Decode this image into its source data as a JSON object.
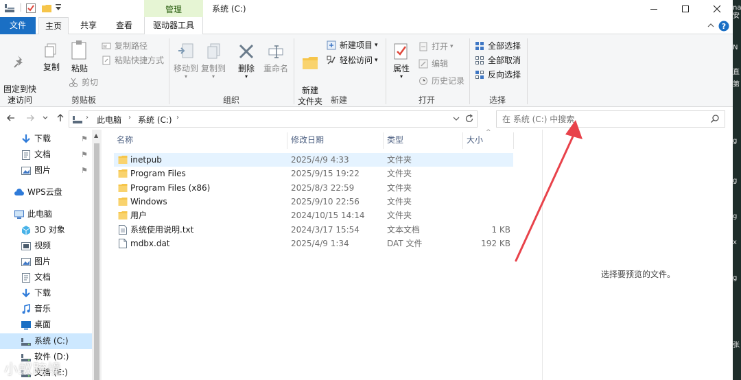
{
  "window": {
    "title": "系统 (C:)",
    "context_tab_group": "管理",
    "controls": {
      "minimize": "minimize",
      "maximize": "maximize",
      "close": "close"
    }
  },
  "ribbon": {
    "tabs": [
      {
        "label": "文件"
      },
      {
        "label": "主页"
      },
      {
        "label": "共享"
      },
      {
        "label": "查看"
      },
      {
        "label": "驱动器工具"
      }
    ],
    "groups": {
      "clipboard": {
        "label": "剪贴板",
        "pin_quick_access": "固定到快\n速访问",
        "copy": "复制",
        "paste": "粘贴",
        "copy_path": "复制路径",
        "paste_shortcut": "粘贴快捷方式",
        "cut": "剪切"
      },
      "organize": {
        "label": "组织",
        "move_to": "移动到",
        "copy_to": "复制到",
        "delete": "删除",
        "rename": "重命名"
      },
      "new": {
        "label": "新建",
        "new_folder": "新建\n文件夹",
        "new_item": "新建项目",
        "easy_access": "轻松访问"
      },
      "open": {
        "label": "打开",
        "properties": "属性",
        "open": "打开",
        "edit": "编辑",
        "history": "历史记录"
      },
      "select": {
        "label": "选择",
        "select_all": "全部选择",
        "select_none": "全部取消",
        "invert": "反向选择"
      }
    }
  },
  "address": {
    "crumbs": [
      "此电脑",
      "系统 (C:)"
    ],
    "search_placeholder": "在 系统 (C:) 中搜索"
  },
  "nav": {
    "items": [
      {
        "label": "下载",
        "icon": "download-icon",
        "pinned": true
      },
      {
        "label": "文档",
        "icon": "document-icon",
        "pinned": true
      },
      {
        "label": "图片",
        "icon": "picture-icon",
        "pinned": true
      },
      {
        "label": "WPS云盘",
        "icon": "cloud-icon",
        "pinned": false
      },
      {
        "label": "此电脑",
        "icon": "computer-icon",
        "pinned": false
      },
      {
        "label": "3D 对象",
        "icon": "cube-icon",
        "pinned": false
      },
      {
        "label": "视频",
        "icon": "video-icon",
        "pinned": false
      },
      {
        "label": "图片",
        "icon": "picture-icon",
        "pinned": false
      },
      {
        "label": "文档",
        "icon": "document-icon",
        "pinned": false
      },
      {
        "label": "下载",
        "icon": "download-icon",
        "pinned": false
      },
      {
        "label": "音乐",
        "icon": "music-icon",
        "pinned": false
      },
      {
        "label": "桌面",
        "icon": "desktop-icon",
        "pinned": false
      },
      {
        "label": "系统 (C:)",
        "icon": "drive-icon",
        "pinned": false,
        "selected": true
      },
      {
        "label": "软件 (D:)",
        "icon": "drive-icon",
        "pinned": false
      },
      {
        "label": "文档 (E:)",
        "icon": "drive-icon",
        "pinned": false
      }
    ]
  },
  "files": {
    "columns": {
      "name": "名称",
      "date": "修改日期",
      "type": "类型",
      "size": "大小"
    },
    "rows": [
      {
        "name": "inetpub",
        "date": "2025/4/9 4:33",
        "type": "文件夹",
        "size": "",
        "icon": "folder-icon"
      },
      {
        "name": "Program Files",
        "date": "2025/9/15 19:22",
        "type": "文件夹",
        "size": "",
        "icon": "folder-icon"
      },
      {
        "name": "Program Files (x86)",
        "date": "2025/8/3 22:59",
        "type": "文件夹",
        "size": "",
        "icon": "folder-icon"
      },
      {
        "name": "Windows",
        "date": "2025/9/10 22:56",
        "type": "文件夹",
        "size": "",
        "icon": "folder-icon"
      },
      {
        "name": "用户",
        "date": "2024/10/15 14:14",
        "type": "文件夹",
        "size": "",
        "icon": "folder-icon"
      },
      {
        "name": "系统使用说明.txt",
        "date": "2024/3/17 15:54",
        "type": "文本文档",
        "size": "1 KB",
        "icon": "text-file-icon"
      },
      {
        "name": "mdbx.dat",
        "date": "2025/4/9 1:34",
        "type": "DAT 文件",
        "size": "192 KB",
        "icon": "file-icon"
      }
    ]
  },
  "preview": {
    "message": "选择要预览的文件。"
  },
  "overlay": {
    "watermark": "小蚁跨境",
    "arrow_color": "#e8424a"
  },
  "colors": {
    "accent": "#1a6fc4",
    "context_tab": "#e6f5d4",
    "selection": "#cde8ff",
    "hover": "#e5f3ff",
    "folder": "#f6c54a"
  },
  "desktop_fragments": [
    "na",
    "安",
    "N",
    "直",
    "第",
    "g",
    "g",
    "g",
    "x",
    "g",
    "张"
  ]
}
